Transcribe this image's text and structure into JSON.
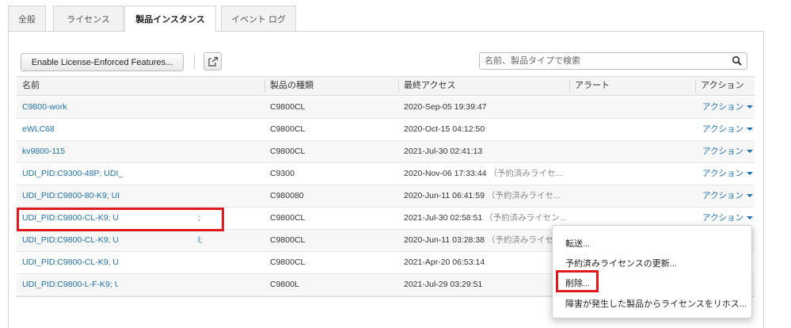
{
  "tabs": [
    "全般",
    "ライセンス",
    "製品インスタンス",
    "イベント ログ"
  ],
  "toolbar": {
    "enable_button": "Enable License-Enforced Features...",
    "export_icon": "export-icon",
    "search_placeholder": "名前、製品タイプで検索",
    "search_icon": "search-icon"
  },
  "table": {
    "headers": [
      "名前",
      "製品の種類",
      "最終アクセス",
      "アラート",
      "アクション"
    ],
    "rows": [
      {
        "name": "C9800-work",
        "type": "C9800CL",
        "access": "2020-Sep-05 19:39:47",
        "note": "",
        "action": "アクション"
      },
      {
        "name": "eWLC68",
        "type": "C9800CL",
        "access": "2020-Oct-15 04:12:50",
        "note": "",
        "action": "アクション"
      },
      {
        "name": "kv9800-115",
        "type": "C9800CL",
        "access": "2021-Jul-30 02:41:13",
        "note": "",
        "action": "アクション"
      },
      {
        "name": "UDI_PID:C9300-48P; UDI_",
        "type": "C9300",
        "access": "2020-Nov-06 17:33:44",
        "note": "（予約済みライセ...",
        "action": "アクション"
      },
      {
        "name": "UDI_PID:C9800-80-K9; UI",
        "type": "C980080",
        "access": "2020-Jun-11 06:41:59",
        "note": "（予約済みライセ...",
        "action": "アクション"
      },
      {
        "name": "UDI_PID:C9800-CL-K9; U",
        "type": "C9800CL",
        "access": "2021-Jul-30 02:58:51",
        "note": "（予約済みライセン...",
        "action": "アクション",
        "suffix": ";"
      },
      {
        "name": "UDI_PID:C9800-CL-K9; U",
        "type": "C9800CL",
        "access": "2020-Jun-11 03:28:38",
        "note": "（予約済みライセン...",
        "action": "",
        "suffix": "l;"
      },
      {
        "name": "UDI_PID:C9800-CL-K9; U",
        "type": "C9800CL",
        "access": "2021-Apr-20 06:53:14",
        "note": "",
        "action": ""
      },
      {
        "name": "UDI_PID:C9800-L-F-K9; U",
        "type": "C9800L",
        "access": "2021-Jul-29 03:29:51",
        "note": "",
        "action": ""
      }
    ]
  },
  "dropdown": {
    "items": [
      "転送...",
      "予約済みライセンスの更新...",
      "削除...",
      "障害が発生した製品からライセンスをリホス..."
    ]
  },
  "colors": {
    "link": "#1f6ea8",
    "highlight": "#e0191f"
  }
}
